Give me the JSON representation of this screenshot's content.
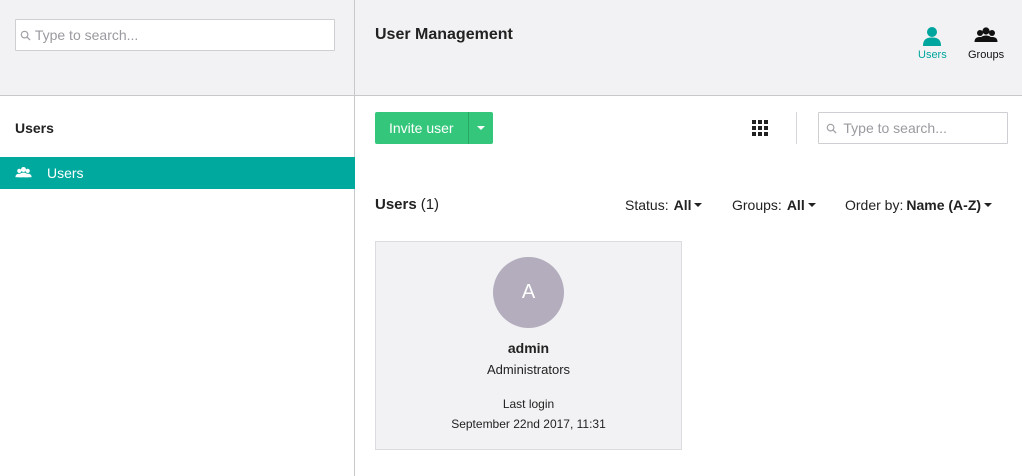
{
  "sidebar_search": {
    "placeholder": "Type to search..."
  },
  "header": {
    "title": "User Management"
  },
  "top_nav": [
    {
      "label": "Users",
      "icon": "user-icon",
      "active": true
    },
    {
      "label": "Groups",
      "icon": "group-icon",
      "active": false
    }
  ],
  "sidebar": {
    "heading": "Users",
    "items": [
      {
        "label": "Users",
        "icon": "group-icon",
        "active": true
      }
    ]
  },
  "toolbar": {
    "invite_label": "Invite user",
    "search_placeholder": "Type to search..."
  },
  "list": {
    "heading": "Users",
    "count": "(1)",
    "filters": {
      "status_label": "Status:",
      "status_value": "All",
      "groups_label": "Groups:",
      "groups_value": "All",
      "order_label": "Order by:",
      "order_value": "Name (A-Z)"
    }
  },
  "users": [
    {
      "initial": "A",
      "name": "admin",
      "group": "Administrators",
      "last_login_label": "Last login",
      "last_login": "September 22nd 2017, 11:31"
    }
  ],
  "colors": {
    "accent": "#00a99d",
    "invite_green": "#34c77b",
    "avatar": "#b3adbd"
  }
}
